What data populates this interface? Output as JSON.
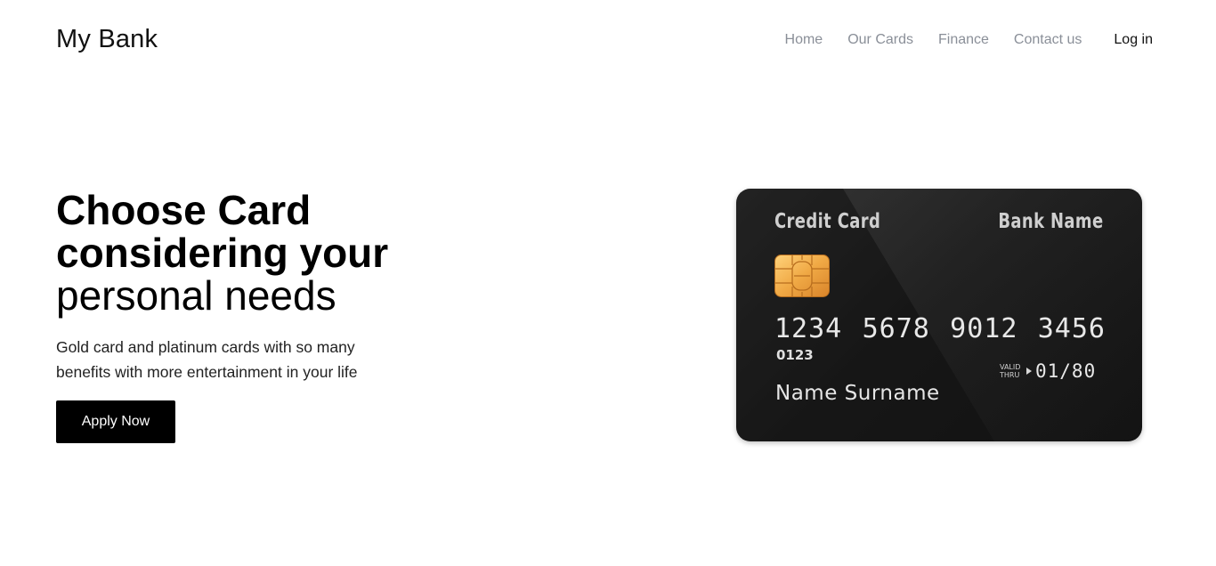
{
  "header": {
    "brand": "My Bank",
    "nav": [
      "Home",
      "Our Cards",
      "Finance",
      "Contact us"
    ],
    "login": "Log in"
  },
  "hero": {
    "title_line1": "Choose Card",
    "title_line2": "considering your",
    "title_line3": "personal needs",
    "subtitle": "Gold card and platinum cards with so many benefits with more entertainment in your life",
    "cta": "Apply Now"
  },
  "card": {
    "type": "Credit Card",
    "bank_name": "Bank Name",
    "number_groups": [
      "1234",
      "5678",
      "9012",
      "3456"
    ],
    "sub_number": "0123",
    "valid_label": "VALID THRU",
    "valid_thru": "01/80",
    "holder": "Name Surname"
  },
  "colors": {
    "nav_text": "#8a8f98",
    "button_bg": "#000000",
    "card_bg": "#1a1a1a",
    "chip": "#f0a945"
  },
  "icons": {
    "chip": "card-chip-icon",
    "arrow": "valid-thru-arrow-icon"
  }
}
